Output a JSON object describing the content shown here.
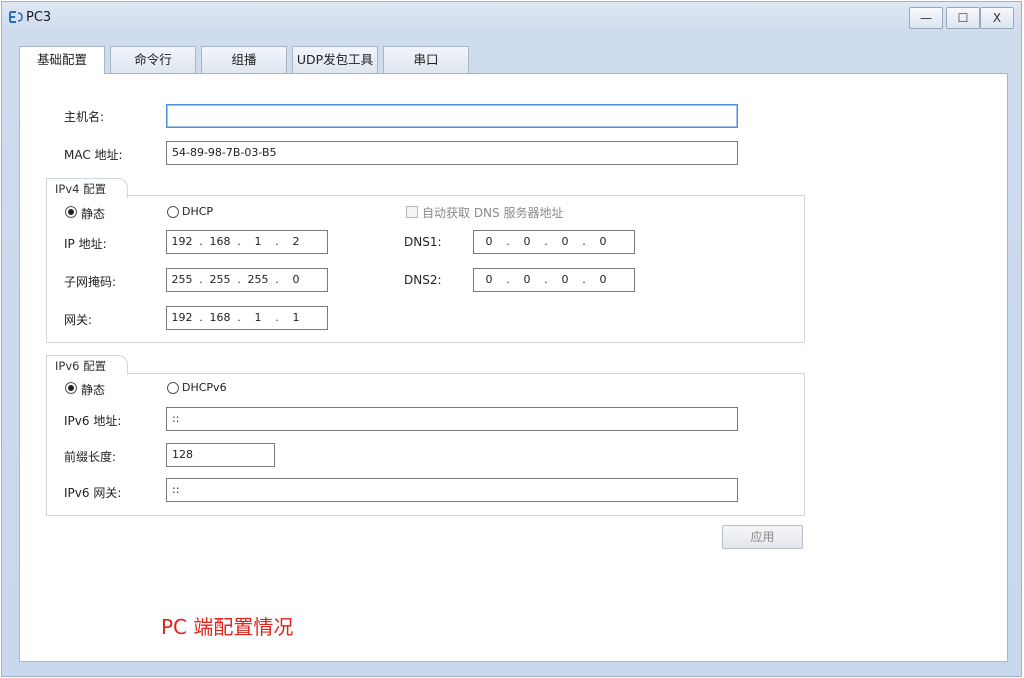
{
  "window": {
    "title": "PC3",
    "controls": {
      "minimize": "—",
      "maximize": "☐",
      "close": "X"
    }
  },
  "tabs": [
    {
      "label": "基础配置",
      "active": true
    },
    {
      "label": "命令行"
    },
    {
      "label": "组播"
    },
    {
      "label": "UDP发包工具"
    },
    {
      "label": "串口"
    }
  ],
  "basic": {
    "hostname_label": "主机名:",
    "hostname_value": "",
    "mac_label": "MAC 地址:",
    "mac_value": "54-89-98-7B-03-B5"
  },
  "ipv4": {
    "group_title": "IPv4 配置",
    "static_label": "静态",
    "dhcp_label": "DHCP",
    "mode": "static",
    "auto_dns_label": "自动获取 DNS 服务器地址",
    "ip_label": "IP 地址:",
    "ip": [
      "192",
      "168",
      "1",
      "2"
    ],
    "mask_label": "子网掩码:",
    "mask": [
      "255",
      "255",
      "255",
      "0"
    ],
    "gateway_label": "网关:",
    "gateway": [
      "192",
      "168",
      "1",
      "1"
    ],
    "dns1_label": "DNS1:",
    "dns1": [
      "0",
      "0",
      "0",
      "0"
    ],
    "dns2_label": "DNS2:",
    "dns2": [
      "0",
      "0",
      "0",
      "0"
    ]
  },
  "ipv6": {
    "group_title": "IPv6 配置",
    "static_label": "静态",
    "dhcp_label": "DHCPv6",
    "mode": "static",
    "addr_label": "IPv6 地址:",
    "addr_value": "::",
    "prefix_label": "前缀长度:",
    "prefix_value": "128",
    "gateway_label": "IPv6 网关:",
    "gateway_value": "::"
  },
  "apply_label": "应用",
  "caption": "PC 端配置情况",
  "colors": {
    "caption": "#e0231c",
    "focus_border": "#4a90d8"
  }
}
